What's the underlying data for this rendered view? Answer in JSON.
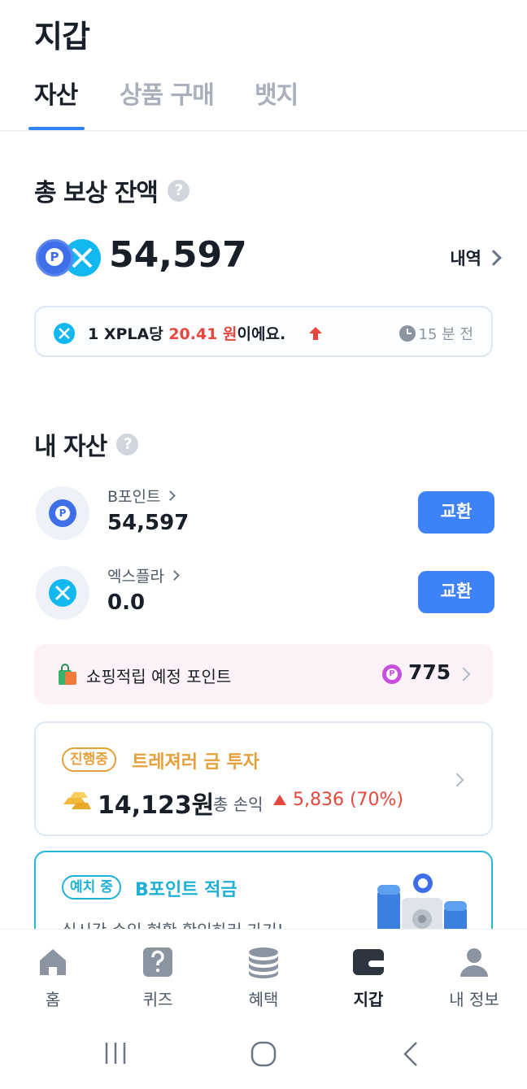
{
  "header": {
    "title": "지갑"
  },
  "tabs": [
    {
      "label": "자산",
      "active": true
    },
    {
      "label": "상품 구매",
      "active": false
    },
    {
      "label": "뱃지",
      "active": false
    }
  ],
  "reward": {
    "title": "총 보상 잔액",
    "help": "?",
    "balance": "54,597",
    "history_label": "내역"
  },
  "rate": {
    "prefix": "1 XPLA당 ",
    "value": "20.41 원",
    "suffix": "이에요.",
    "direction": "up",
    "time_label": "15 분 전"
  },
  "assets": {
    "title": "내 자산",
    "help": "?",
    "items": [
      {
        "name": "B포인트",
        "value": "54,597",
        "button": "교환",
        "icon": "b-point-icon"
      },
      {
        "name": "엑스플라",
        "value": "0.0",
        "button": "교환",
        "icon": "xpla-icon"
      }
    ]
  },
  "shopping": {
    "label": "쇼핑적립 예정 포인트",
    "value": "775"
  },
  "gold": {
    "badge": "진행중",
    "title": "트레져러 금 투자",
    "value": "14,123원",
    "pl_label": "총 손익",
    "pl_value": "5,836 (70%)"
  },
  "saving": {
    "badge": "예치 중",
    "title": "B포인트 적금",
    "subtitle": "실시간 수익 현황 확인하러 가기!"
  },
  "bottom_nav": [
    {
      "label": "홈",
      "icon": "home-icon",
      "active": false
    },
    {
      "label": "퀴즈",
      "icon": "quiz-icon",
      "active": false
    },
    {
      "label": "혜택",
      "icon": "coins-icon",
      "active": false
    },
    {
      "label": "지갑",
      "icon": "wallet-icon",
      "active": true
    },
    {
      "label": "내 정보",
      "icon": "user-icon",
      "active": false
    }
  ],
  "colors": {
    "accent": "#3182f6",
    "button": "#3e82f7",
    "up_red": "#e5473e",
    "gold": "#e6a03b",
    "teal": "#1fb0d6"
  }
}
